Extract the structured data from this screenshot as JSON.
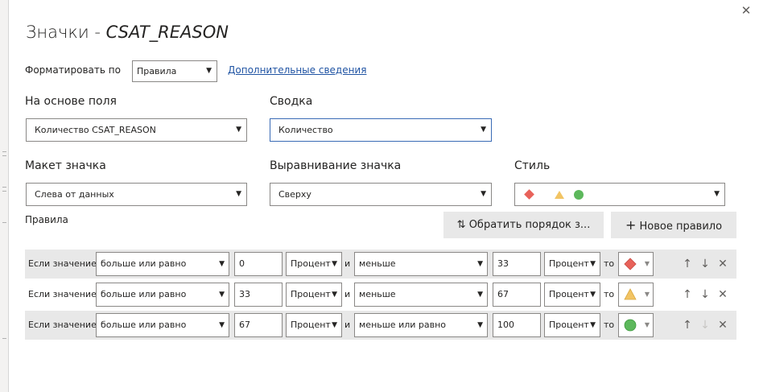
{
  "dialog": {
    "title_prefix": "Значки - ",
    "title_field": "CSAT_REASON",
    "close_glyph": "✕"
  },
  "format_by": {
    "label": "Форматировать по",
    "value": "Правила",
    "link": "Дополнительные сведения"
  },
  "based_on": {
    "label": "На основе поля",
    "value": "Количество CSAT_REASON"
  },
  "summary": {
    "label": "Сводка",
    "value": "Количество"
  },
  "layout": {
    "label": "Макет значка",
    "value": "Слева от данных"
  },
  "alignment": {
    "label": "Выравнивание значка",
    "value": "Сверху"
  },
  "style": {
    "label": "Стиль",
    "icons": [
      "red-diamond",
      "yellow-triangle",
      "green-circle"
    ],
    "colors": {
      "red": "#e8625a",
      "yellow": "#f2c464",
      "green": "#5db85c"
    }
  },
  "rules": {
    "label": "Правила",
    "reverse_button": "Обратить порядок з...",
    "new_button": "Новое правило",
    "if_label": "Если значение",
    "and_label": "и",
    "to_label": "то",
    "items": [
      {
        "op1": "больше или равно",
        "v1": "0",
        "unit1": "Процент",
        "op2": "меньше",
        "v2": "33",
        "unit2": "Процент",
        "icon": "red-diamond"
      },
      {
        "op1": "больше или равно",
        "v1": "33",
        "unit1": "Процент",
        "op2": "меньше",
        "v2": "67",
        "unit2": "Процент",
        "icon": "yellow-triangle"
      },
      {
        "op1": "больше или равно",
        "v1": "67",
        "unit1": "Процент",
        "op2": "меньше или равно",
        "v2": "100",
        "unit2": "Процент",
        "icon": "green-circle"
      }
    ]
  },
  "accent": "#3a6bb5"
}
